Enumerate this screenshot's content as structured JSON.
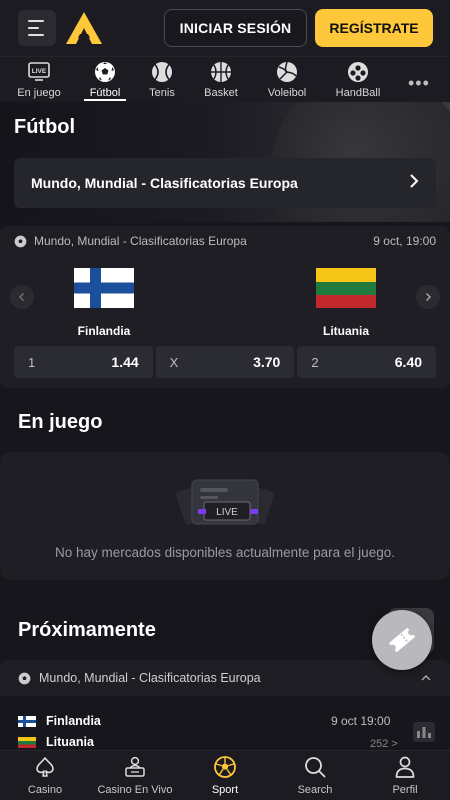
{
  "header": {
    "login_label": "INICIAR SESIÓN",
    "register_label": "REGÍSTRATE",
    "accent_color": "#ffc83a"
  },
  "sports_nav": {
    "items": [
      {
        "label": "En juego",
        "icon": "live-tv-icon"
      },
      {
        "label": "Fútbol",
        "icon": "soccer-ball-icon",
        "active": true
      },
      {
        "label": "Tenis",
        "icon": "tennis-ball-icon"
      },
      {
        "label": "Basket",
        "icon": "basketball-icon"
      },
      {
        "label": "Voleibol",
        "icon": "volleyball-icon"
      },
      {
        "label": "HandBall",
        "icon": "handball-icon"
      }
    ],
    "live_badge": "LIVE"
  },
  "hero": {
    "title": "Fútbol",
    "competition": "Mundo, Mundial - Clasificatorias Europa"
  },
  "featured_match": {
    "competition": "Mundo, Mundial - Clasificatorias Europa",
    "date": "9 oct, 19:00",
    "home": "Finlandia",
    "away": "Lituania",
    "odds": [
      {
        "key": "1",
        "value": "1.44"
      },
      {
        "key": "X",
        "value": "3.70"
      },
      {
        "key": "2",
        "value": "6.40"
      }
    ]
  },
  "live_section": {
    "title": "En juego",
    "badge": "LIVE",
    "empty_message": "No hay mercados disponibles actualmente para el juego."
  },
  "upcoming_section": {
    "title": "Próximamente",
    "competition": "Mundo, Mundial - Clasificatorias Europa",
    "match": {
      "home": "Finlandia",
      "away": "Lituania",
      "date": "9 oct 19:00",
      "more": "252 >"
    }
  },
  "bottom_nav": {
    "items": [
      {
        "label": "Casino",
        "icon": "spade-icon"
      },
      {
        "label": "Casino En Vivo",
        "icon": "dealer-icon"
      },
      {
        "label": "Sport",
        "icon": "soccer-ball-icon",
        "active": true
      },
      {
        "label": "Search",
        "icon": "search-icon"
      },
      {
        "label": "Perfil",
        "icon": "user-icon"
      }
    ]
  }
}
